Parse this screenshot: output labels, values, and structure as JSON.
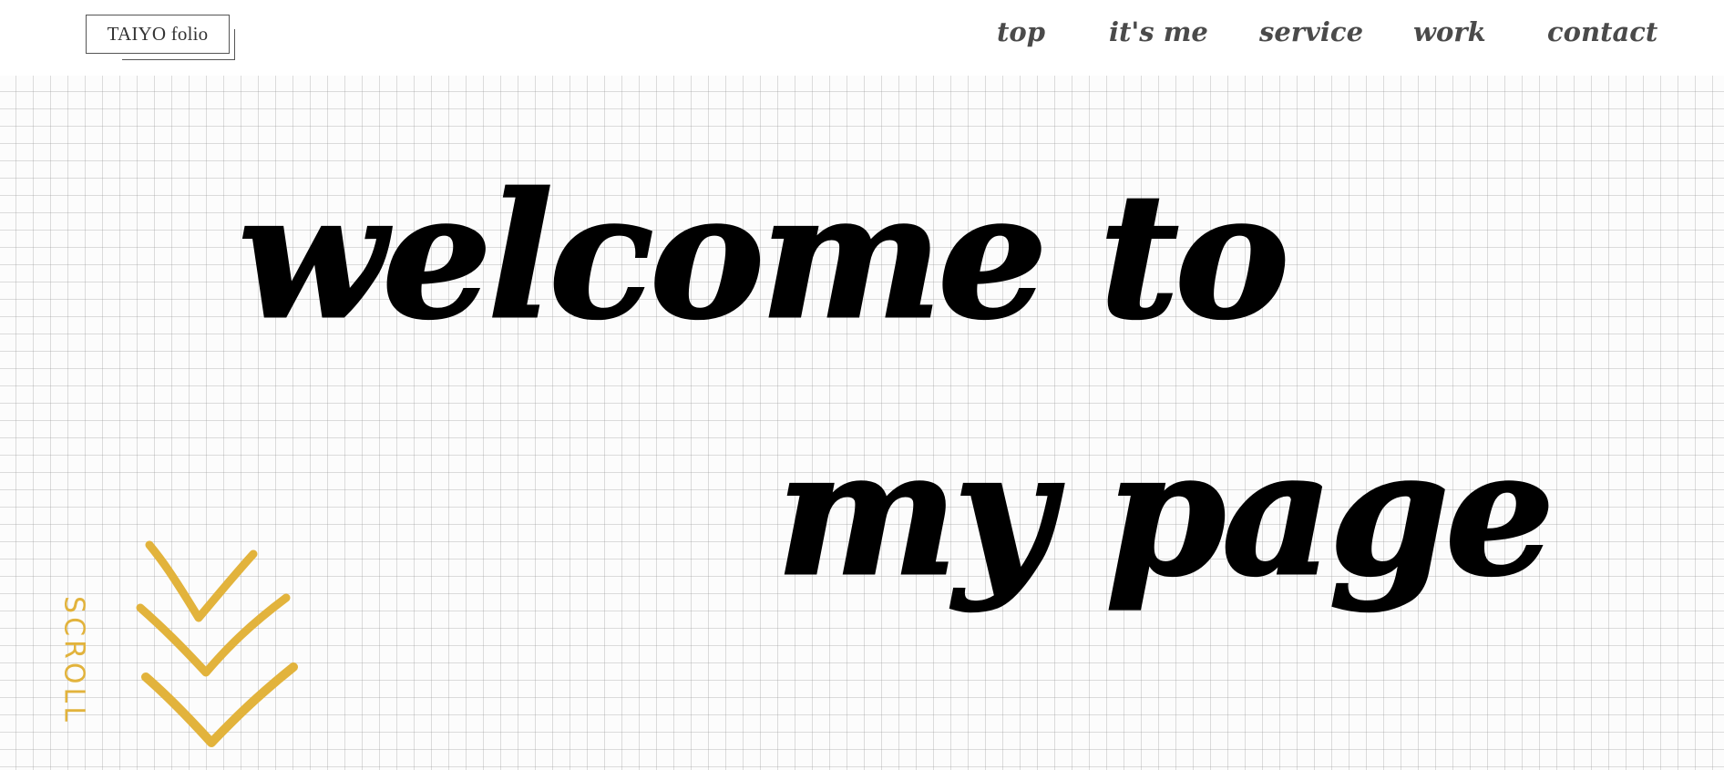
{
  "header": {
    "logo": "TAIYO folio",
    "nav": [
      {
        "label": "top"
      },
      {
        "label": "it's me"
      },
      {
        "label": "service"
      },
      {
        "label": "work"
      },
      {
        "label": "contact"
      }
    ]
  },
  "hero": {
    "line1": "welcome to",
    "line2": "my page"
  },
  "scroll": {
    "label": "SCROLL",
    "color": "#e2b33c"
  },
  "icons": {
    "scroll": "triple-chevron-down-icon"
  }
}
